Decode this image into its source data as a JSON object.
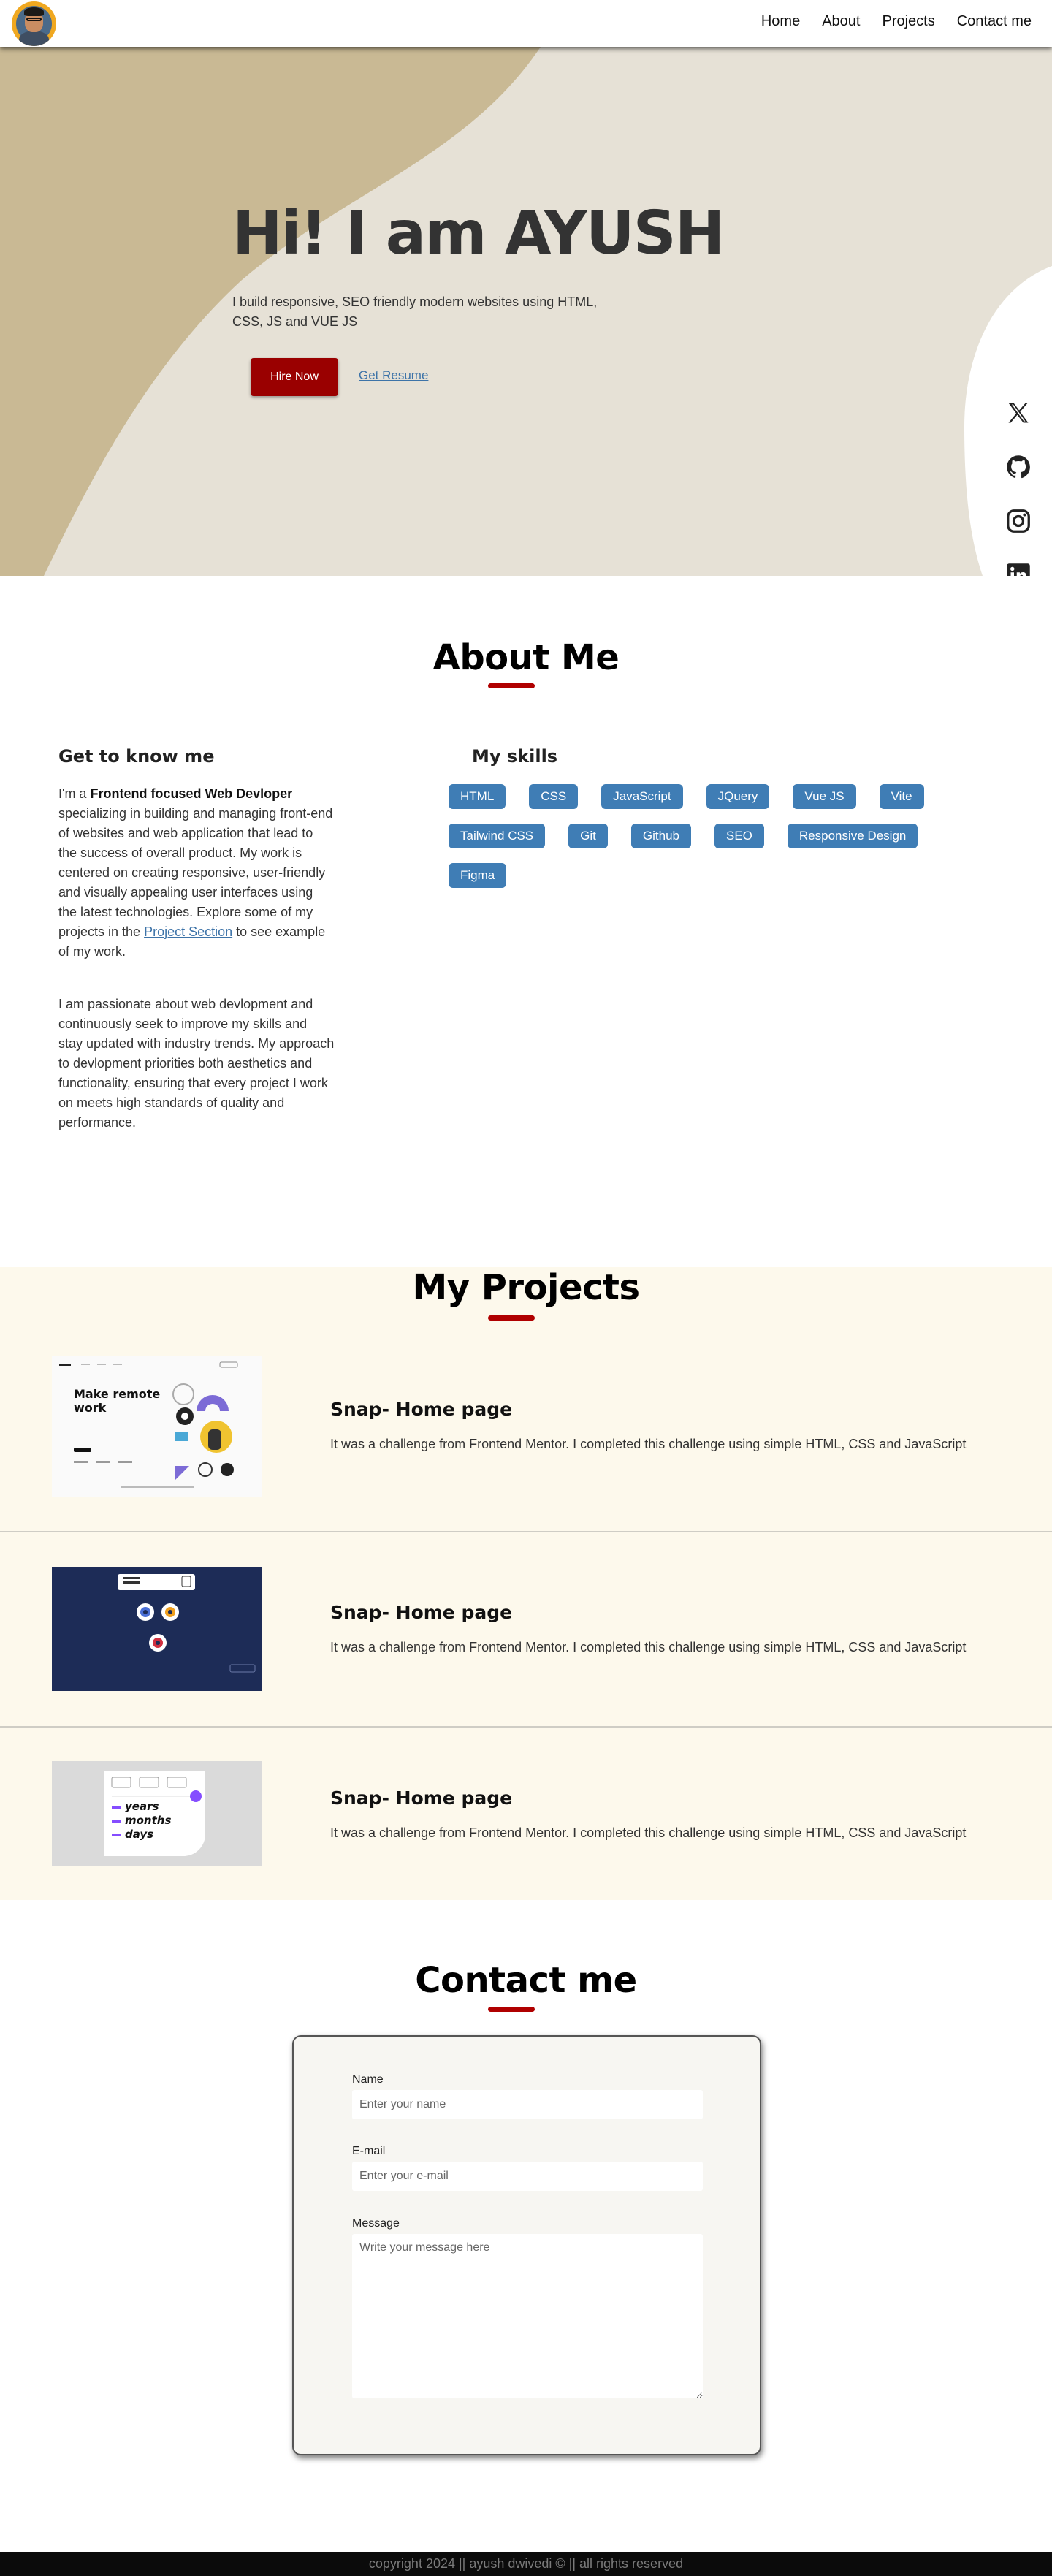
{
  "header": {
    "nav": [
      "Home",
      "About",
      "Projects",
      "Contact me"
    ]
  },
  "hero": {
    "title": "Hi! I am AYUSH",
    "subtitle": "I build responsive, SEO friendly modern websites using HTML, CSS, JS and VUE JS",
    "hire_label": "Hire Now",
    "resume_label": "Get Resume",
    "colors": {
      "background": "#e6e1d6",
      "shape": "#c9b994",
      "button": "#9a0000"
    },
    "social_icons": [
      "x-icon",
      "github-icon",
      "instagram-icon",
      "linkedin-icon"
    ]
  },
  "about": {
    "title": "About Me",
    "left_heading": "Get to know me",
    "p1_before": "I'm a ",
    "p1_bold": "Frontend focused Web Devloper",
    "p1_after": " specializing in building and managing front-end of websites and web application that lead to the success of overall product. My work is centered on creating responsive, user-friendly and visually appealing user interfaces using the latest technologies. Explore some of my projects in the ",
    "p1_link": "Project Section",
    "p1_end": " to see example of my work.",
    "p2": "I am passionate about web devlopment and continuously seek to improve my skills and stay updated with industry trends. My approach to devlopment priorities both aesthetics and functionality, ensuring that every project I work on meets high standards of quality and performance.",
    "skills_heading": "My skills",
    "skills": [
      "HTML",
      "CSS",
      "JavaScript",
      "JQuery",
      "Vue JS",
      "Vite",
      "Tailwind CSS",
      "Git",
      "Github",
      "SEO",
      "Responsive Design",
      "Figma"
    ]
  },
  "projects": {
    "title": "My Projects",
    "items": [
      {
        "title": "Snap- Home page",
        "description": "It was a challenge from Frontend Mentor. I completed this challenge using simple HTML, CSS and JavaScript",
        "thumb_text": "Make remote work"
      },
      {
        "title": "Snap- Home page",
        "description": "It was a challenge from Frontend Mentor. I completed this challenge using simple HTML, CSS and JavaScript"
      },
      {
        "title": "Snap- Home page",
        "description": "It was a challenge from Frontend Mentor. I completed this challenge using simple HTML, CSS and JavaScript",
        "thumb_lines": [
          "years",
          "months",
          "days"
        ]
      }
    ]
  },
  "contact": {
    "title": "Contact me",
    "name_label": "Name",
    "name_placeholder": "Enter your name",
    "email_label": "E-mail",
    "email_placeholder": "Enter your e-mail",
    "message_label": "Message",
    "message_placeholder": "Write your message here"
  },
  "footer": {
    "text": "copyright 2024 || ayush dwivedi © || all rights reserved"
  }
}
